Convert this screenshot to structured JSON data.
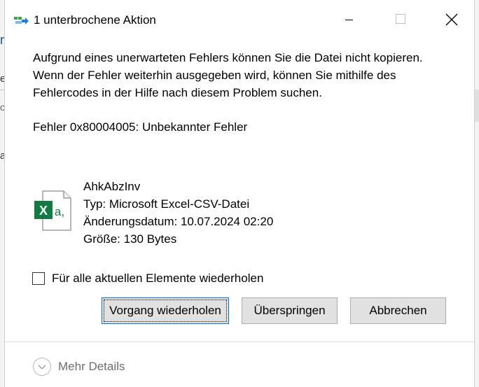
{
  "background": {
    "left_glyphs": [
      "n",
      "e",
      "o",
      "a"
    ]
  },
  "dialog": {
    "title": "1 unterbrochene Aktion",
    "message": [
      "Aufgrund eines unerwarteten Fehlers können Sie die Datei nicht kopieren.",
      "Wenn der Fehler weiterhin ausgegeben wird, können Sie mithilfe des",
      "Fehlercodes in der Hilfe nach diesem Problem suchen."
    ],
    "error_code": "Fehler 0x80004005: Unbekannter Fehler",
    "file": {
      "name": "AhkAbzInv",
      "type": "Typ: Microsoft Excel-CSV-Datei",
      "modified": "Änderungsdatum: 10.07.2024 02:20",
      "size": "Größe: 130 Bytes",
      "icon": "excel-csv-file-icon"
    },
    "repeat_checkbox": {
      "label": "Für alle aktuellen Elemente wiederholen",
      "checked": false
    },
    "buttons": {
      "retry": "Vorgang wiederholen",
      "skip": "Überspringen",
      "cancel": "Abbrechen"
    },
    "more_details": "Mehr Details"
  },
  "colors": {
    "excel_green": "#107c41",
    "focus_blue": "#0078d7",
    "button_bg": "#e1e1e1",
    "muted_text": "#6d6d6d"
  }
}
